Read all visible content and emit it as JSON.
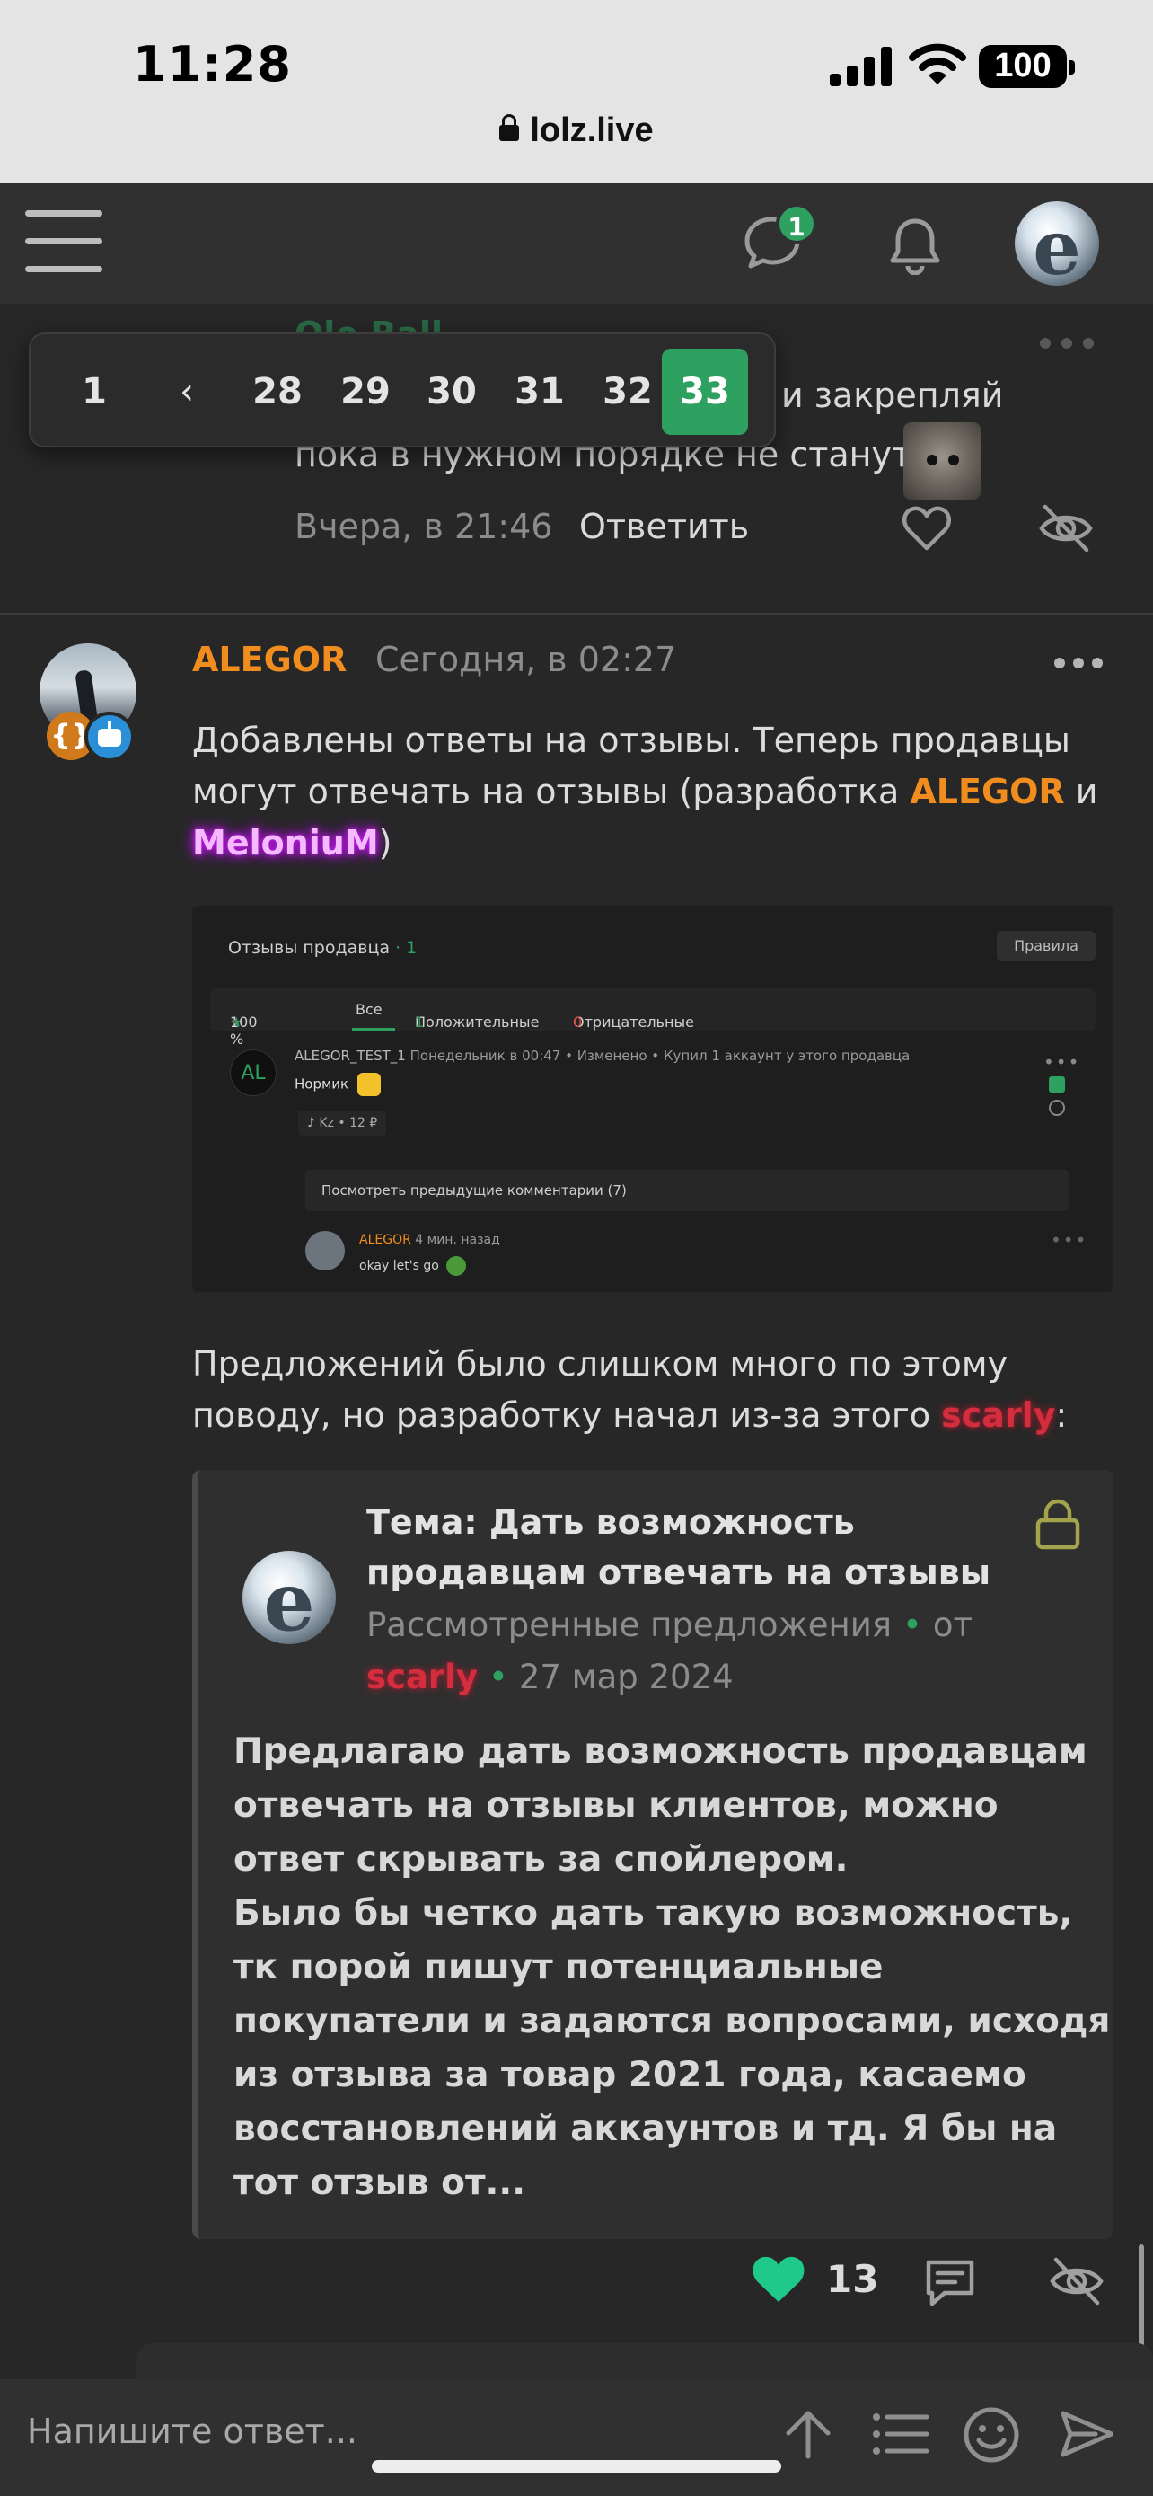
{
  "status_bar": {
    "time": "11:28",
    "battery": "100",
    "url": "lolz.live",
    "icons": [
      "signal-icon",
      "wifi-icon",
      "battery-icon",
      "lock-icon"
    ]
  },
  "header": {
    "icons": [
      "hamburger-icon",
      "chat-icon",
      "bell-icon"
    ],
    "chat_badge": "1"
  },
  "previous_post": {
    "author": "Ole Ball",
    "line1": "и закрепляй",
    "line2": "пока в нужном порядке не станут",
    "time": "Вчера, в 21:46",
    "reply": "Ответить"
  },
  "pagination": {
    "first": "1",
    "prev": "‹",
    "pages": [
      "28",
      "29",
      "30",
      "31",
      "32"
    ],
    "current": "33"
  },
  "post": {
    "author": "ALEGOR",
    "time": "Сегодня, в 02:27",
    "badge_code": "{}",
    "text_part1": "Добавлены ответы на отзывы. Теперь продавцы могут отвечать на отзывы (разработка ",
    "mention1": "ALEGOR",
    "text_and": " и ",
    "mention2": "MeloniuM",
    "text_close": ")",
    "text2_part1": "Предложений было слишком много по этому поводу, но разработку начал из-за этого ",
    "mention3": "scarly",
    "text2_close": ":",
    "likes": "13"
  },
  "screenshot": {
    "title": "Отзывы продавца",
    "title_count": "1",
    "rules": "Правила",
    "tab_percent": "100 %",
    "tab_all": "Все",
    "tab_positive": "Положительные",
    "tab_positive_count": "1",
    "tab_negative": "Отрицательные",
    "tab_negative_count": "0",
    "avatar_initials": "AL",
    "user": "ALEGOR_TEST_1",
    "meta": "Понедельник в 00:47  •  Изменено  •  Купил 1 аккаунт у этого продавца",
    "body": "Нормик",
    "tag": "Kz  •  12 ₽",
    "show_prev": "Посмотреть предыдущие комментарии (7)",
    "reply_author": "ALEGOR",
    "reply_time": "4 мин. назад",
    "reply_body": "okay let's go"
  },
  "quote": {
    "title": "Тема: Дать возможность продавцам отвечать на отзывы",
    "category": "Рассмотренные предложения",
    "from": "от",
    "author": "scarly",
    "date": "27 мар 2024",
    "body": "Предлагаю дать возможность продавцам отвечать на отзывы клиентов, можно ответ скрывать за спойлером.\nБыло бы четко дать такую возможность, тк порой пишут потенциальные покупатели и задаются вопросами, исходя из отзыва за товар 2021 года, касаемо восстановлений аккаунтов и тд. Я бы на тот отзыв от..."
  },
  "reply_bar": {
    "placeholder": "Напишите ответ..."
  },
  "colors": {
    "accent_green": "#2ea05f",
    "author_orange": "#f08d1e",
    "background": "#272727"
  }
}
